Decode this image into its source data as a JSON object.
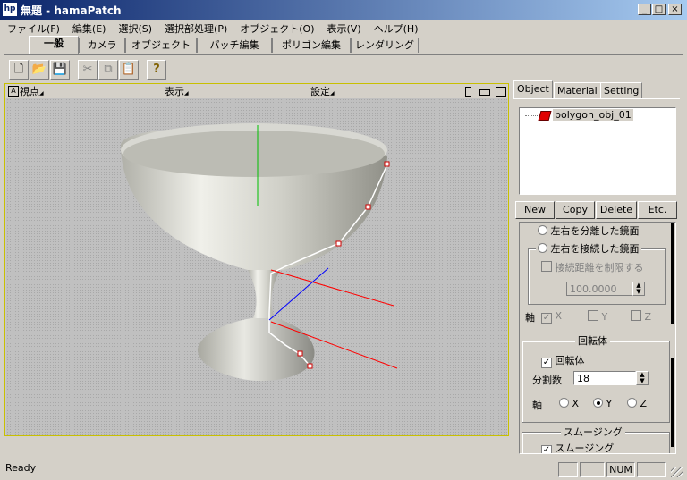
{
  "window": {
    "app_icon_label": "hp",
    "title": "無題 - hamaPatch",
    "min_glyph": "_",
    "max_glyph": "□",
    "close_glyph": "×"
  },
  "menu": [
    "ファイル(F)",
    "編集(E)",
    "選択(S)",
    "選択部処理(P)",
    "オブジェクト(O)",
    "表示(V)",
    "ヘルプ(H)"
  ],
  "tabs": [
    "一般",
    "カメラ",
    "オブジェクト",
    "パッチ編集",
    "ポリゴン編集",
    "レンダリング"
  ],
  "active_tab": "一般",
  "toolbar": {
    "new_glyph": "🗋",
    "open_glyph": "📂",
    "save_glyph": "💾",
    "cut_glyph": "✂",
    "copy_glyph": "⧉",
    "paste_glyph": "📋",
    "help_glyph": "?"
  },
  "viewport": {
    "corner_label": "A",
    "menu_view": "視点",
    "menu_display": "表示",
    "menu_settings": "設定",
    "border_color": "#c8c000",
    "axis_colors": {
      "x": "#ff0000",
      "y": "#00c000",
      "z": "#0000ff"
    }
  },
  "panel": {
    "tabs": [
      "Object",
      "Material",
      "Setting"
    ],
    "active_tab": "Object",
    "tree_item": "polygon_obj_01",
    "buttons": [
      "New",
      "Copy",
      "Delete",
      "Etc."
    ],
    "mirror": {
      "option_separate": "左右を分離した鏡面",
      "option_connected": "左右を接続した鏡面",
      "limit_label": "接続距離を制限する",
      "limit_value": "100.0000",
      "axis_label": "軸",
      "axes": [
        "X",
        "Y",
        "Z"
      ]
    },
    "revolve": {
      "group_title": "回転体",
      "enable_label": "回転体",
      "divisions_label": "分割数",
      "divisions_value": "18",
      "axis_label": "軸",
      "axes": [
        "X",
        "Y",
        "Z"
      ],
      "selected_axis": "Y"
    },
    "smoothing": {
      "group_title": "スムージング",
      "enable_label": "スムージング"
    }
  },
  "status": {
    "text": "Ready",
    "num_indicator": "NUM"
  }
}
